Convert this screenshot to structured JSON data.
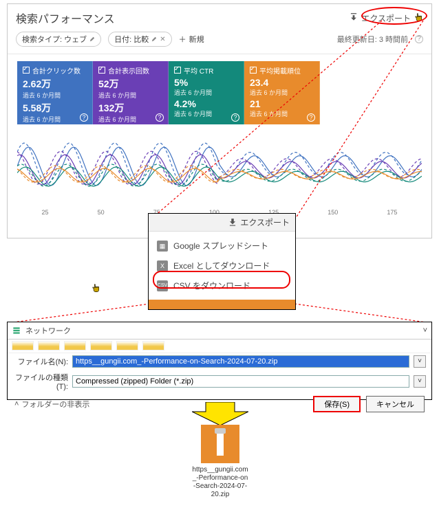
{
  "header": {
    "title": "検索パフォーマンス",
    "export_label": "エクスポート"
  },
  "filters": {
    "chip1": "検索タイプ: ウェブ",
    "chip2": "日付: 比較",
    "addnew": "新規",
    "lastupdate": "最終更新日: 3 時間前"
  },
  "metrics": [
    {
      "title": "合計クリック数",
      "v1": "2.62万",
      "s1": "過去 6 か月間",
      "v2": "5.58万",
      "s2": "過去 6 か月間"
    },
    {
      "title": "合計表示回数",
      "v1": "52万",
      "s1": "過去 6 か月間",
      "v2": "132万",
      "s2": "過去 6 か月間"
    },
    {
      "title": "平均 CTR",
      "v1": "5%",
      "s1": "過去 6 か月間",
      "v2": "4.2%",
      "s2": "過去 6 か月間"
    },
    {
      "title": "平均掲載順位",
      "v1": "23.4",
      "s1": "過去 6 か月間",
      "v2": "21",
      "s2": "過去 6 か月間"
    }
  ],
  "xlabels": [
    "25",
    "50",
    "75",
    "100",
    "125",
    "150",
    "175"
  ],
  "exportpop": {
    "button": "エクスポート",
    "item1": "Google スプレッドシート",
    "item2": "Excel としてダウンロード",
    "item3": "CSV をダウンロード"
  },
  "save": {
    "network": "ネットワーク",
    "name_label": "ファイル名(N):",
    "name_value": "https__gungii.com_-Performance-on-Search-2024-07-20.zip",
    "type_label": "ファイルの種類(T):",
    "type_value": "Compressed (zipped) Folder (*.zip)",
    "folder_hide": "フォルダーの非表示",
    "save_btn": "保存(S)",
    "cancel_btn": "キャンセル"
  },
  "file": {
    "name": "https__gungii.com_-Performance-on-Search-2024-07-20.zip"
  },
  "chart_data": {
    "type": "line",
    "xlabel": "",
    "ylabel": "",
    "x_ticks": [
      25,
      50,
      75,
      100,
      125,
      150,
      175
    ],
    "series": [
      {
        "name": "clicks-current",
        "color": "#3f72c0",
        "style": "solid"
      },
      {
        "name": "clicks-prev",
        "color": "#3f72c0",
        "style": "dash"
      },
      {
        "name": "impr-current",
        "color": "#6a3fb5",
        "style": "solid"
      },
      {
        "name": "impr-prev",
        "color": "#6a3fb5",
        "style": "dash"
      },
      {
        "name": "ctr-current",
        "color": "#13897b",
        "style": "solid"
      },
      {
        "name": "ctr-prev",
        "color": "#13897b",
        "style": "dash"
      },
      {
        "name": "pos-current",
        "color": "#e88b2c",
        "style": "solid"
      },
      {
        "name": "pos-prev",
        "color": "#e88b2c",
        "style": "dash"
      }
    ],
    "note": "周期的な波形（週次パターン）。右半分は左半分よりおおむね低い振幅。数値軸ラベルなし。"
  }
}
